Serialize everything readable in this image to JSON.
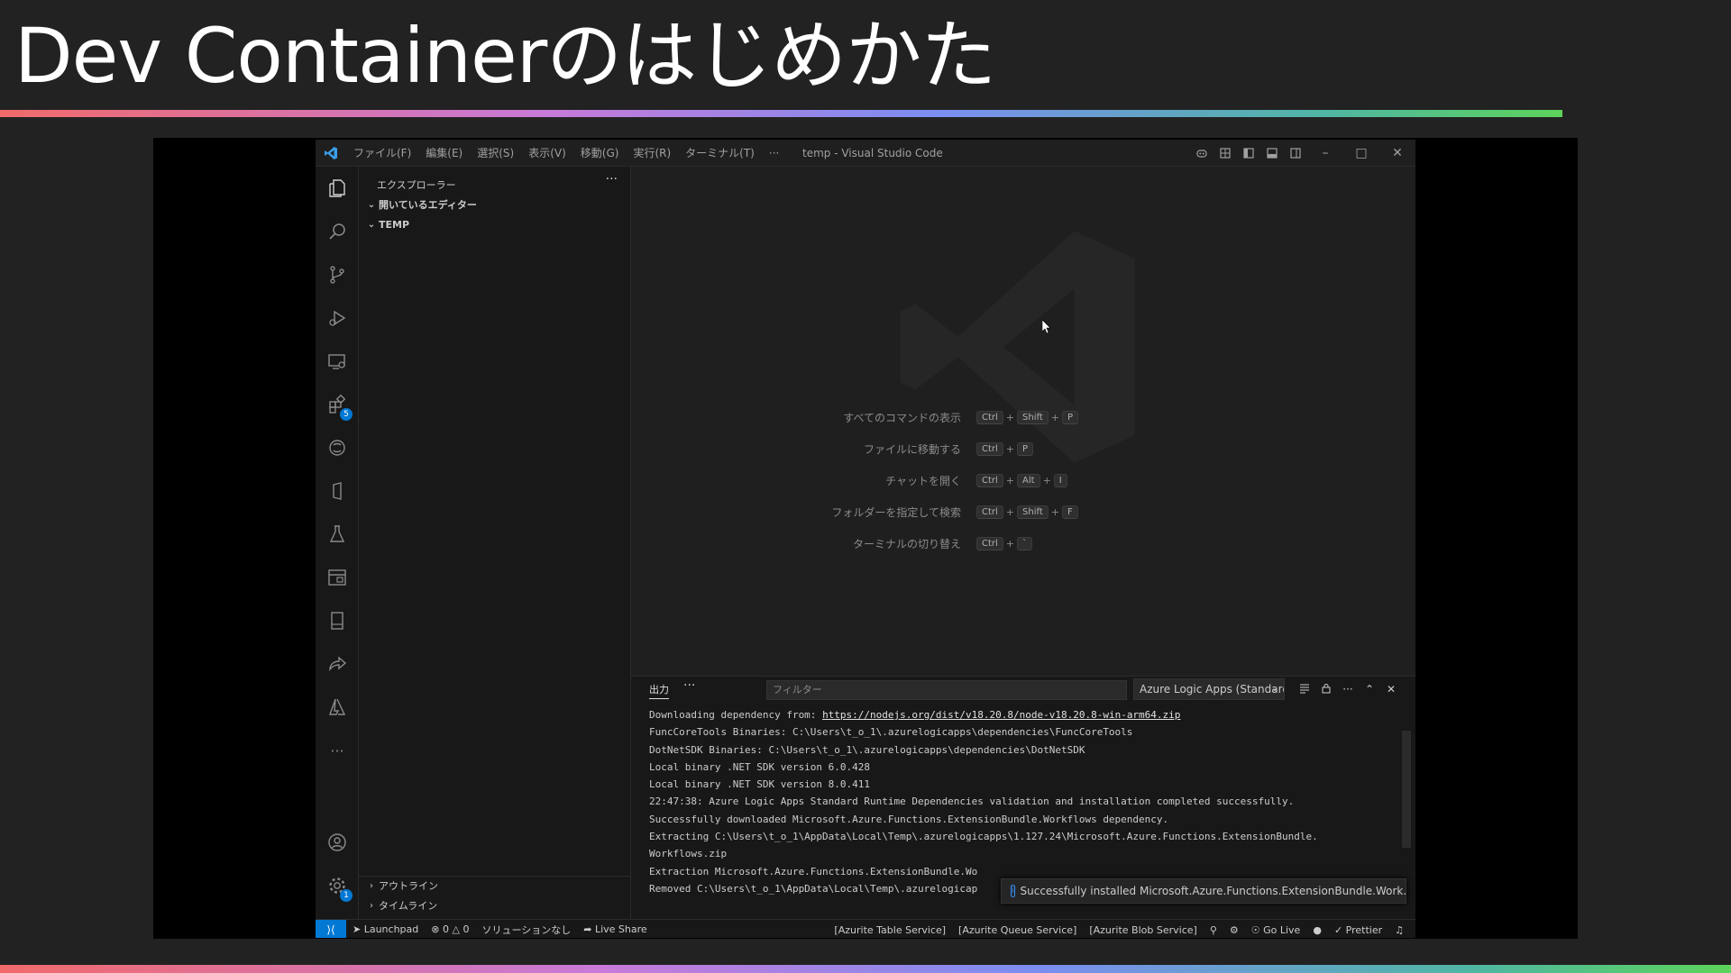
{
  "slide": {
    "title": "Dev Containerのはじめかた"
  },
  "titlebar": {
    "menus": [
      "ファイル(F)",
      "編集(E)",
      "選択(S)",
      "表示(V)",
      "移動(G)",
      "実行(R)",
      "ターミナル(T)",
      "···"
    ],
    "window_title": "temp - Visual Studio Code"
  },
  "sidebar": {
    "header": "エクスプローラー",
    "more": "···",
    "open_editors": "開いているエディター",
    "folder": "TEMP",
    "outline": "アウトライン",
    "timeline": "タイムライン"
  },
  "activity": {
    "extensions_badge": "5",
    "settings_badge": "1",
    "more": "···"
  },
  "welcome": {
    "shortcuts": [
      {
        "label": "すべてのコマンドの表示",
        "keys": [
          "Ctrl",
          "Shift",
          "P"
        ]
      },
      {
        "label": "ファイルに移動する",
        "keys": [
          "Ctrl",
          "P"
        ]
      },
      {
        "label": "チャットを開く",
        "keys": [
          "Ctrl",
          "Alt",
          "I"
        ]
      },
      {
        "label": "フォルダーを指定して検索",
        "keys": [
          "Ctrl",
          "Shift",
          "F"
        ]
      },
      {
        "label": "ターミナルの切り替え",
        "keys": [
          "Ctrl",
          "`"
        ]
      }
    ],
    "plus": "+"
  },
  "panel": {
    "tab": "出力",
    "more": "···",
    "filter_placeholder": "フィルター",
    "channel": "Azure Logic Apps (Standard)",
    "lines": [
      {
        "text": "Downloading dependency from: ",
        "link": "https://nodejs.org/dist/v18.20.8/node-v18.20.8-win-arm64.zip"
      },
      {
        "text": "FuncCoreTools Binaries: C:\\Users\\t_o_1\\.azurelogicapps\\dependencies\\FuncCoreTools",
        "link": ""
      },
      {
        "text": "DotNetSDK Binaries: C:\\Users\\t_o_1\\.azurelogicapps\\dependencies\\DotNetSDK",
        "link": ""
      },
      {
        "text": "Local binary .NET SDK version 6.0.428",
        "link": ""
      },
      {
        "text": "Local binary .NET SDK version 8.0.411",
        "link": ""
      },
      {
        "text": "22:47:38: Azure Logic Apps Standard Runtime Dependencies validation and installation completed successfully.",
        "link": ""
      },
      {
        "text": "Successfully downloaded Microsoft.Azure.Functions.ExtensionBundle.Workflows dependency.",
        "link": ""
      },
      {
        "text": "Extracting C:\\Users\\t_o_1\\AppData\\Local\\Temp\\.azurelogicapps\\1.127.24\\Microsoft.Azure.Functions.ExtensionBundle.",
        "link": ""
      },
      {
        "text": "Workflows.zip",
        "link": ""
      },
      {
        "text": "Extraction Microsoft.Azure.Functions.ExtensionBundle.Wo",
        "link": ""
      },
      {
        "text": "Removed C:\\Users\\t_o_1\\AppData\\Local\\Temp\\.azurelogicap",
        "link": ""
      }
    ]
  },
  "toast": {
    "message": "Successfully installed Microsoft.Azure.Functions.ExtensionBundle.Work..."
  },
  "statusbar": {
    "launchpad": "Launchpad",
    "errors": "0",
    "warnings": "0",
    "solution": "ソリューションなし",
    "live_share": "Live Share",
    "table_service": "[Azurite Table Service]",
    "queue_service": "[Azurite Queue Service]",
    "blob_service": "[Azurite Blob Service]",
    "go_live": "Go Live",
    "prettier": "Prettier"
  },
  "colors": {
    "accent": "#0078d4",
    "background": "#1f1f1f"
  }
}
